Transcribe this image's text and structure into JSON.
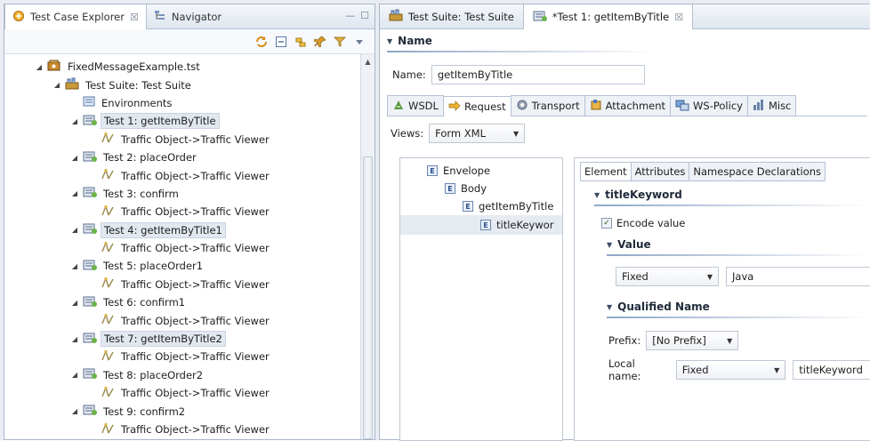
{
  "left_view": {
    "tabs": [
      {
        "label": "Test Case Explorer",
        "close": "☒",
        "icon": "test-case-explorer-icon"
      },
      {
        "label": "Navigator",
        "icon": "navigator-icon"
      }
    ],
    "window_controls": {
      "minimize": "—",
      "maximize": "☐"
    },
    "toolbar_icons": [
      "refresh-icon",
      "collapse-all-icon",
      "link-icon",
      "pin-icon",
      "filter-icon",
      "view-menu-icon"
    ],
    "tree": [
      {
        "label": "FixedMessageExample.tst",
        "indent": 0,
        "icon": "tst-file-icon",
        "twisty": "◢"
      },
      {
        "label": "Test Suite: Test Suite",
        "indent": 1,
        "icon": "test-suite-icon",
        "twisty": "◢"
      },
      {
        "label": "Environments",
        "indent": 2,
        "icon": "environments-icon"
      },
      {
        "label": "Test 1: getItemByTitle",
        "indent": 2,
        "icon": "test-icon",
        "twisty": "◢",
        "highlight": true
      },
      {
        "label": "Traffic Object->Traffic Viewer",
        "indent": 3,
        "icon": "traffic-viewer-icon"
      },
      {
        "label": "Test 2: placeOrder",
        "indent": 2,
        "icon": "test-icon",
        "twisty": "◢"
      },
      {
        "label": "Traffic Object->Traffic Viewer",
        "indent": 3,
        "icon": "traffic-viewer-icon"
      },
      {
        "label": "Test 3: confirm",
        "indent": 2,
        "icon": "test-icon",
        "twisty": "◢"
      },
      {
        "label": "Traffic Object->Traffic Viewer",
        "indent": 3,
        "icon": "traffic-viewer-icon"
      },
      {
        "label": "Test 4: getItemByTitle1",
        "indent": 2,
        "icon": "test-icon",
        "twisty": "◢",
        "highlight": true
      },
      {
        "label": "Traffic Object->Traffic Viewer",
        "indent": 3,
        "icon": "traffic-viewer-icon"
      },
      {
        "label": "Test 5: placeOrder1",
        "indent": 2,
        "icon": "test-icon",
        "twisty": "◢"
      },
      {
        "label": "Traffic Object->Traffic Viewer",
        "indent": 3,
        "icon": "traffic-viewer-icon"
      },
      {
        "label": "Test 6: confirm1",
        "indent": 2,
        "icon": "test-icon",
        "twisty": "◢"
      },
      {
        "label": "Traffic Object->Traffic Viewer",
        "indent": 3,
        "icon": "traffic-viewer-icon"
      },
      {
        "label": "Test 7: getItemByTitle2",
        "indent": 2,
        "icon": "test-icon",
        "twisty": "◢",
        "highlight": true
      },
      {
        "label": "Traffic Object->Traffic Viewer",
        "indent": 3,
        "icon": "traffic-viewer-icon"
      },
      {
        "label": "Test 8: placeOrder2",
        "indent": 2,
        "icon": "test-icon",
        "twisty": "◢"
      },
      {
        "label": "Traffic Object->Traffic Viewer",
        "indent": 3,
        "icon": "traffic-viewer-icon"
      },
      {
        "label": "Test 9: confirm2",
        "indent": 2,
        "icon": "test-icon",
        "twisty": "◢"
      },
      {
        "label": "Traffic Object->Traffic Viewer",
        "indent": 3,
        "icon": "traffic-viewer-icon"
      }
    ],
    "scrollbar": {
      "up": "▲",
      "down": "▼"
    }
  },
  "editor": {
    "tabs": [
      {
        "label": "Test Suite: Test Suite",
        "icon": "test-suite-icon"
      },
      {
        "label": "*Test 1: getItemByTitle",
        "close": "☒",
        "icon": "test-icon"
      }
    ],
    "name_section": {
      "title": "Name",
      "field_label": "Name:",
      "value": "getItemByTitle"
    },
    "sub_tabs": [
      {
        "label": "WSDL",
        "icon": "wsdl-icon"
      },
      {
        "label": "Request",
        "icon": "request-icon"
      },
      {
        "label": "Transport",
        "icon": "transport-icon"
      },
      {
        "label": "Attachment",
        "icon": "attachment-icon"
      },
      {
        "label": "WS-Policy",
        "icon": "ws-policy-icon"
      },
      {
        "label": "Misc",
        "icon": "misc-icon"
      }
    ],
    "views": {
      "label": "Views:",
      "value": "Form XML"
    },
    "xml_tree": [
      {
        "label": "Envelope",
        "badge": "E"
      },
      {
        "label": "Body",
        "badge": "E"
      },
      {
        "label": "getItemByTitle",
        "badge": "E"
      },
      {
        "label": "titleKeywor",
        "badge": "E"
      }
    ],
    "detail": {
      "tabs": [
        "Element",
        "Attributes",
        "Namespace Declarations"
      ],
      "element_title": "titleKeyword",
      "encode_label": "Encode value",
      "encode_checked": "✓",
      "value_title": "Value",
      "value_mode": "Fixed",
      "value_text": "Java",
      "qname_title": "Qualified Name",
      "prefix_label": "Prefix:",
      "prefix_value": "[No Prefix]",
      "local_label": "Local name:",
      "local_mode": "Fixed",
      "local_value": "titleKeyword"
    }
  },
  "colors": {
    "accent": "#8ea6c6",
    "selection": "#e2e8f0",
    "border": "#a9b6c8"
  }
}
